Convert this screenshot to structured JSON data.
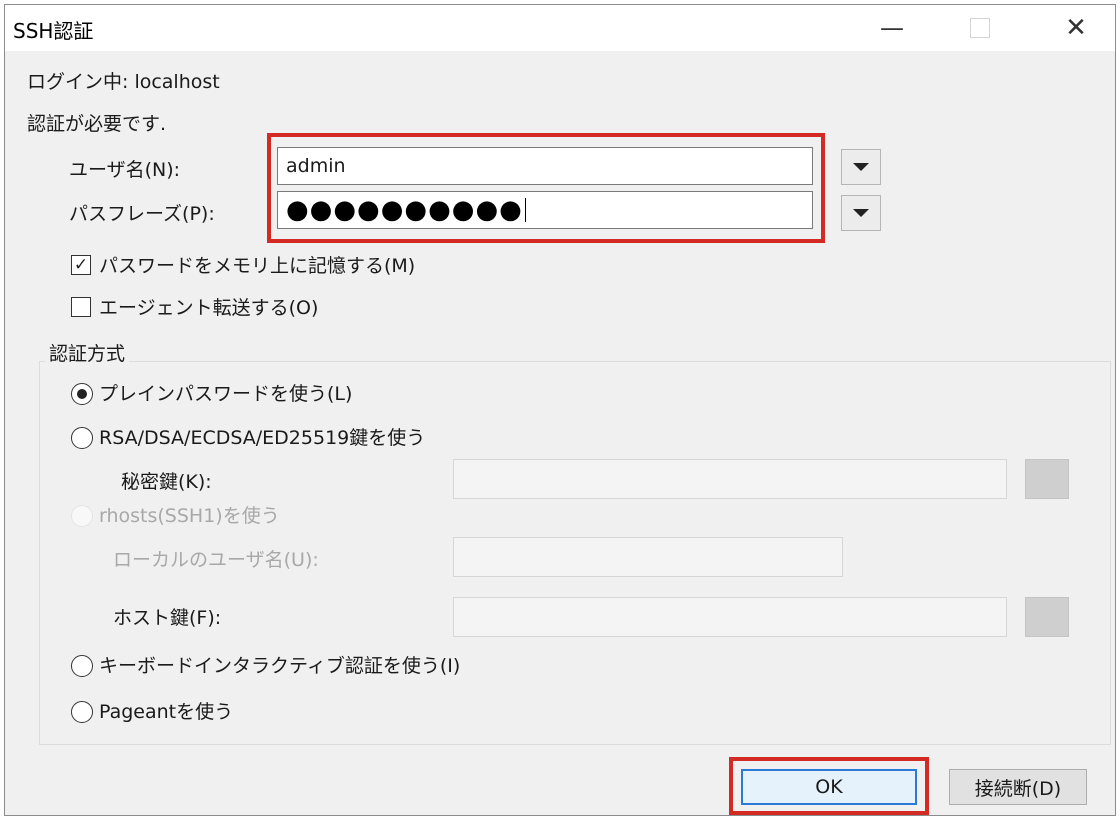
{
  "window": {
    "title": "SSH認証",
    "controls": {
      "minimize": "—",
      "close": "✕"
    }
  },
  "status": {
    "login_line": "ログイン中: localhost",
    "auth_required": "認証が必要です."
  },
  "fields": {
    "username_label": "ユーザ名(N):",
    "username_value": "admin",
    "passphrase_label": "パスフレーズ(P):",
    "passphrase_masked": "●●●●●●●●●●"
  },
  "options": {
    "remember_password": {
      "label": "パスワードをメモリ上に記憶する(M)",
      "checked": true,
      "mark": "✓"
    },
    "agent_forwarding": {
      "label": "エージェント転送する(O)",
      "checked": false
    }
  },
  "auth_method": {
    "title": "認証方式",
    "plain_password": {
      "label": "プレインパスワードを使う(L)",
      "selected": true
    },
    "key_auth": {
      "label": "RSA/DSA/ECDSA/ED25519鍵を使う",
      "selected": false
    },
    "private_key_label": "秘密鍵(K):",
    "rhosts": {
      "label": "rhosts(SSH1)を使う",
      "enabled": false
    },
    "local_user_label": "ローカルのユーザ名(U):",
    "host_key_label": "ホスト鍵(F):",
    "keyboard_interactive": {
      "label": "キーボードインタラクティブ認証を使う(I)",
      "selected": false
    },
    "pageant": {
      "label": "Pageantを使う",
      "selected": false
    }
  },
  "buttons": {
    "ok": "OK",
    "disconnect": "接続断(D)"
  },
  "colors": {
    "highlight": "#d32b23",
    "default_button_border": "#2a7ad6",
    "dialog_bg": "#f0f0f0"
  }
}
